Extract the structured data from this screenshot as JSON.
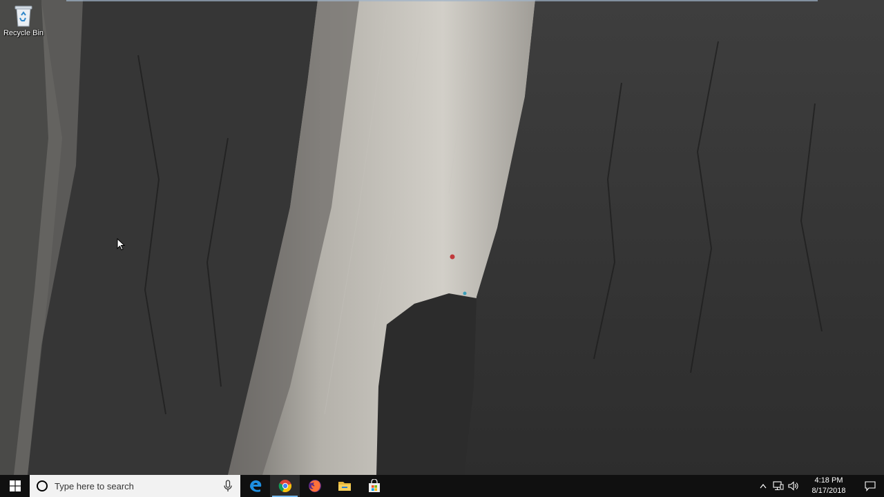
{
  "desktop": {
    "icons": [
      {
        "label": "Recycle Bin",
        "icon": "recycle-bin-icon"
      }
    ]
  },
  "taskbar": {
    "start_icon": "windows-logo-icon",
    "search": {
      "placeholder": "Type here to search",
      "icon": "cortana-circle-icon",
      "mic_icon": "microphone-icon"
    },
    "apps": [
      {
        "name": "Microsoft Edge",
        "icon": "edge-icon",
        "state": "pinned"
      },
      {
        "name": "Google Chrome",
        "icon": "chrome-icon",
        "state": "active"
      },
      {
        "name": "Firefox",
        "icon": "firefox-icon",
        "state": "pinned"
      },
      {
        "name": "File Explorer",
        "icon": "folder-icon",
        "state": "pinned"
      },
      {
        "name": "Microsoft Store",
        "icon": "store-bag-icon",
        "state": "pinned"
      }
    ],
    "tray": {
      "icons": [
        "chevron-up-icon",
        "network-icon",
        "volume-icon"
      ],
      "time": "4:18 PM",
      "date": "8/17/2018",
      "notification_icon": "action-center-icon"
    }
  },
  "colors": {
    "taskbar_bg": "#101010",
    "accent": "#76b9ed",
    "search_bg": "#f2f2f2"
  }
}
